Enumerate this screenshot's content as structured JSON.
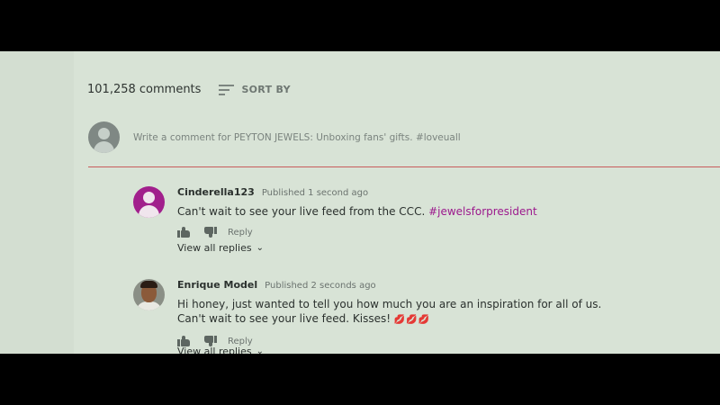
{
  "comments_header": {
    "count": "101,258 comments",
    "sort_label": "SORT BY",
    "sort_icon": "sort-icon"
  },
  "compose": {
    "placeholder": "Write a comment for PEYTON JEWELS: Unboxing fans' gifts. #loveuall",
    "avatar_icon": "user-avatar-icon",
    "underline_color": "#c85c5c"
  },
  "comments": [
    {
      "author": "Cinderella123",
      "time": "Published 1 second ago",
      "text": "Can't wait to see your live feed from the CCC. ",
      "hashtag": "#jewelsforpresident",
      "reply_label": "Reply",
      "view_replies": "View all replies",
      "avatar_color": "#a11f8c"
    },
    {
      "author": "Enrique Model",
      "time": "Published 2 seconds ago",
      "text_line1": "Hi honey, just wanted to tell you how much you are an inspiration for all of us.",
      "text_line2": "Can't wait to see your live feed. Kisses! ",
      "emoji": "💋💋💋",
      "reply_label": "Reply",
      "view_replies": "View all replies"
    }
  ],
  "colors": {
    "hashtag": "#9c1a8d",
    "background": "#d8e3d6"
  }
}
